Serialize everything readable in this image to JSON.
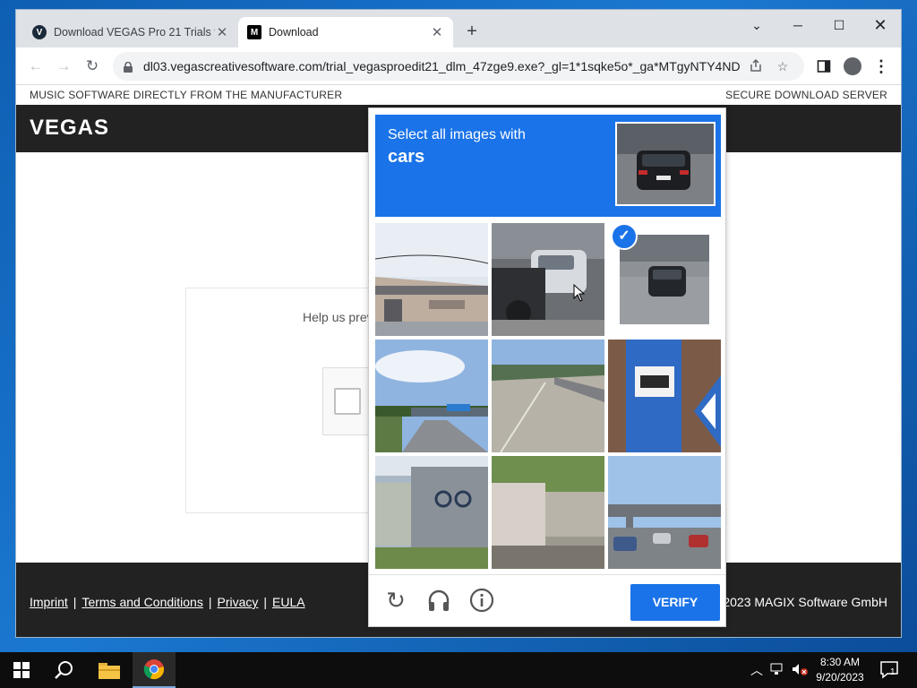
{
  "browser": {
    "tabs": [
      {
        "title": "Download VEGAS Pro 21 Trials fo",
        "favicon_letter": "V"
      },
      {
        "title": "Download",
        "favicon_letter": "M"
      }
    ],
    "url": "dl03.vegascreativesoftware.com/trial_vegasproedit21_dlm_47zge9.exe?_gl=1*1sqke5o*_ga*MTgyNTY4NDc..."
  },
  "page": {
    "top_left": "MUSIC SOFTWARE DIRECTLY FROM THE MANUFACTURER",
    "top_right": "SECURE DOWNLOAD SERVER",
    "logo": "VEGAS",
    "background_text": "Help us preve... prompted... experiencin...",
    "footer_links": [
      "Imprint",
      "Terms and Conditions",
      "Privacy",
      "EULA"
    ],
    "copyright": "2023 MAGIX Software GmbH"
  },
  "captcha": {
    "instruction": "Select all images with",
    "target": "cars",
    "verify_label": "VERIFY",
    "selected_tile": 3,
    "tiles": [
      {
        "index": 1,
        "desc": "house-roof"
      },
      {
        "index": 2,
        "desc": "parked-car-motorbikes"
      },
      {
        "index": 3,
        "desc": "car-on-road",
        "selected": true
      },
      {
        "index": 4,
        "desc": "highway-bridge"
      },
      {
        "index": 5,
        "desc": "empty-road"
      },
      {
        "index": 6,
        "desc": "bus-stop-sign"
      },
      {
        "index": 7,
        "desc": "building-bicycle-sign"
      },
      {
        "index": 8,
        "desc": "street-with-wall"
      },
      {
        "index": 9,
        "desc": "overpass-cars"
      }
    ]
  },
  "taskbar": {
    "time": "8:30 AM",
    "date": "9/20/2023",
    "notification_count": "1"
  },
  "colors": {
    "accent": "#1a73e8",
    "header_bg": "#222222",
    "desktop": "#1b78d0"
  }
}
